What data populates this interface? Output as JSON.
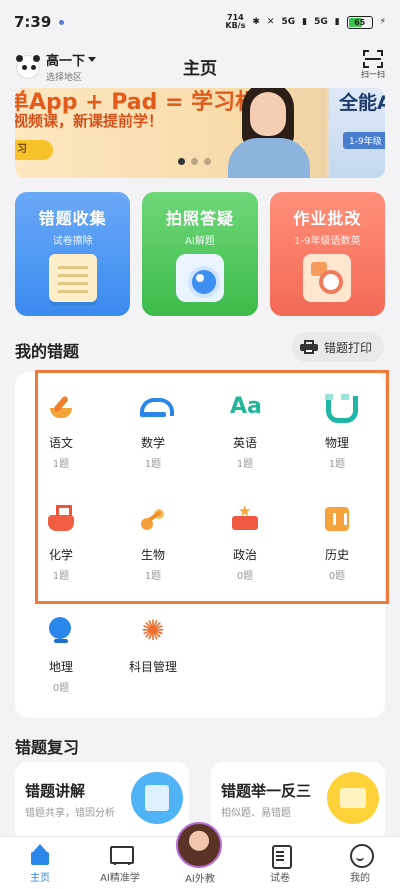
{
  "status_bar": {
    "time": "7:39",
    "net_speed_value": "714",
    "net_speed_unit": "KB/s",
    "signal1": "5G",
    "signal2": "5G",
    "battery": "65"
  },
  "header": {
    "grade": "高一下",
    "region": "选择地区",
    "title": "主页",
    "scan_label": "扫一扫"
  },
  "banner": {
    "slide1_line1": "单App + Pad = 学习机",
    "slide1_line2": "视频课，新课提前学！",
    "slide1_button": "习",
    "slide2_line1": "全能A",
    "slide2_tag": "1-9年级"
  },
  "features": [
    {
      "title": "错题收集",
      "subtitle": "试卷擦除",
      "icon": "paper-icon"
    },
    {
      "title": "拍照答疑",
      "subtitle": "AI解题",
      "icon": "camera-icon"
    },
    {
      "title": "作业批改",
      "subtitle": "1-9年级语数英",
      "icon": "homework-icon"
    }
  ],
  "mistakes": {
    "title": "我的错题",
    "print_label": "错题打印",
    "subjects": [
      {
        "name": "语文",
        "count": "1题",
        "icon": "pen-icon"
      },
      {
        "name": "数学",
        "count": "1题",
        "icon": "protractor-icon"
      },
      {
        "name": "英语",
        "count": "1题",
        "icon": "aa-letters-icon"
      },
      {
        "name": "物理",
        "count": "1题",
        "icon": "magnet-icon"
      },
      {
        "name": "化学",
        "count": "1题",
        "icon": "flask-icon"
      },
      {
        "name": "生物",
        "count": "1题",
        "icon": "molecule-icon"
      },
      {
        "name": "政治",
        "count": "0题",
        "icon": "star-flag-icon"
      },
      {
        "name": "历史",
        "count": "0题",
        "icon": "scroll-icon"
      },
      {
        "name": "地理",
        "count": "0题",
        "icon": "globe-icon"
      },
      {
        "name": "科目管理",
        "count": "",
        "icon": "gear-icon"
      }
    ],
    "en_glyph": "Aa"
  },
  "review": {
    "title": "错题复习",
    "cards": [
      {
        "title": "错题讲解",
        "subtitle": "错题共享，错因分析"
      },
      {
        "title": "错题举一反三",
        "subtitle": "相似题、易错题"
      }
    ]
  },
  "tabbar": [
    {
      "label": "主页",
      "active": true
    },
    {
      "label": "AI精准学",
      "active": false
    },
    {
      "label": "AI外教",
      "active": false
    },
    {
      "label": "试卷",
      "active": false
    },
    {
      "label": "我的",
      "active": false
    }
  ],
  "colors": {
    "accent": "#2a86e8",
    "highlight_border": "#f07a3a"
  }
}
